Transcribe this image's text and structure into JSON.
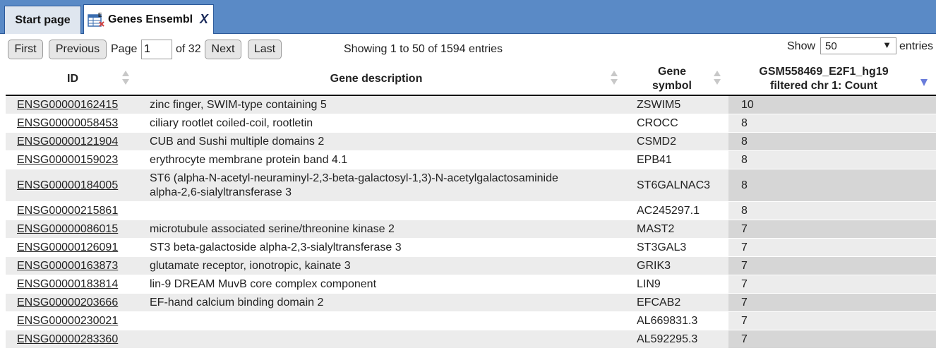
{
  "tabs": [
    {
      "label": "Start page"
    },
    {
      "label": "Genes Ensembl",
      "close": "X"
    }
  ],
  "pager": {
    "first": "First",
    "previous": "Previous",
    "page_label": "Page",
    "page_value": "1",
    "of_label": "of 32",
    "next": "Next",
    "last": "Last",
    "info": "Showing 1 to 50 of 1594 entries",
    "show_label": "Show",
    "show_value": "50",
    "entries_label": "entries"
  },
  "columns": {
    "id": "ID",
    "desc": "Gene description",
    "sym_line1": "Gene",
    "sym_line2": "symbol",
    "count_line1": "GSM558469_E2F1_hg19",
    "count_line2": "filtered chr 1: Count"
  },
  "rows": [
    {
      "id": "ENSG00000162415",
      "desc": "zinc finger, SWIM-type containing 5",
      "desc2": "",
      "sym": "ZSWIM5",
      "count": "10"
    },
    {
      "id": "ENSG00000058453",
      "desc": "ciliary rootlet coiled-coil, rootletin",
      "desc2": "",
      "sym": "CROCC",
      "count": "8"
    },
    {
      "id": "ENSG00000121904",
      "desc": "CUB and Sushi multiple domains 2",
      "desc2": "",
      "sym": "CSMD2",
      "count": "8"
    },
    {
      "id": "ENSG00000159023",
      "desc": "erythrocyte membrane protein band 4.1",
      "desc2": "",
      "sym": "EPB41",
      "count": "8"
    },
    {
      "id": "ENSG00000184005",
      "desc": "ST6 (alpha-N-acetyl-neuraminyl-2,3-beta-galactosyl-1,3)-N-acetylgalactosaminide",
      "desc2": "alpha-2,6-sialyltransferase 3",
      "sym": "ST6GALNAC3",
      "count": "8"
    },
    {
      "id": "ENSG00000215861",
      "desc": "",
      "desc2": "",
      "sym": "AC245297.1",
      "count": "8"
    },
    {
      "id": "ENSG00000086015",
      "desc": "microtubule associated serine/threonine kinase 2",
      "desc2": "",
      "sym": "MAST2",
      "count": "7"
    },
    {
      "id": "ENSG00000126091",
      "desc": "ST3 beta-galactoside alpha-2,3-sialyltransferase 3",
      "desc2": "",
      "sym": "ST3GAL3",
      "count": "7"
    },
    {
      "id": "ENSG00000163873",
      "desc": "glutamate receptor, ionotropic, kainate 3",
      "desc2": "",
      "sym": "GRIK3",
      "count": "7"
    },
    {
      "id": "ENSG00000183814",
      "desc": "lin-9 DREAM MuvB core complex component",
      "desc2": "",
      "sym": "LIN9",
      "count": "7"
    },
    {
      "id": "ENSG00000203666",
      "desc": "EF-hand calcium binding domain 2",
      "desc2": "",
      "sym": "EFCAB2",
      "count": "7"
    },
    {
      "id": "ENSG00000230021",
      "desc": "",
      "desc2": "",
      "sym": "AL669831.3",
      "count": "7"
    },
    {
      "id": "ENSG00000283360",
      "desc": "",
      "desc2": "",
      "sym": "AL592295.3",
      "count": "7"
    }
  ]
}
